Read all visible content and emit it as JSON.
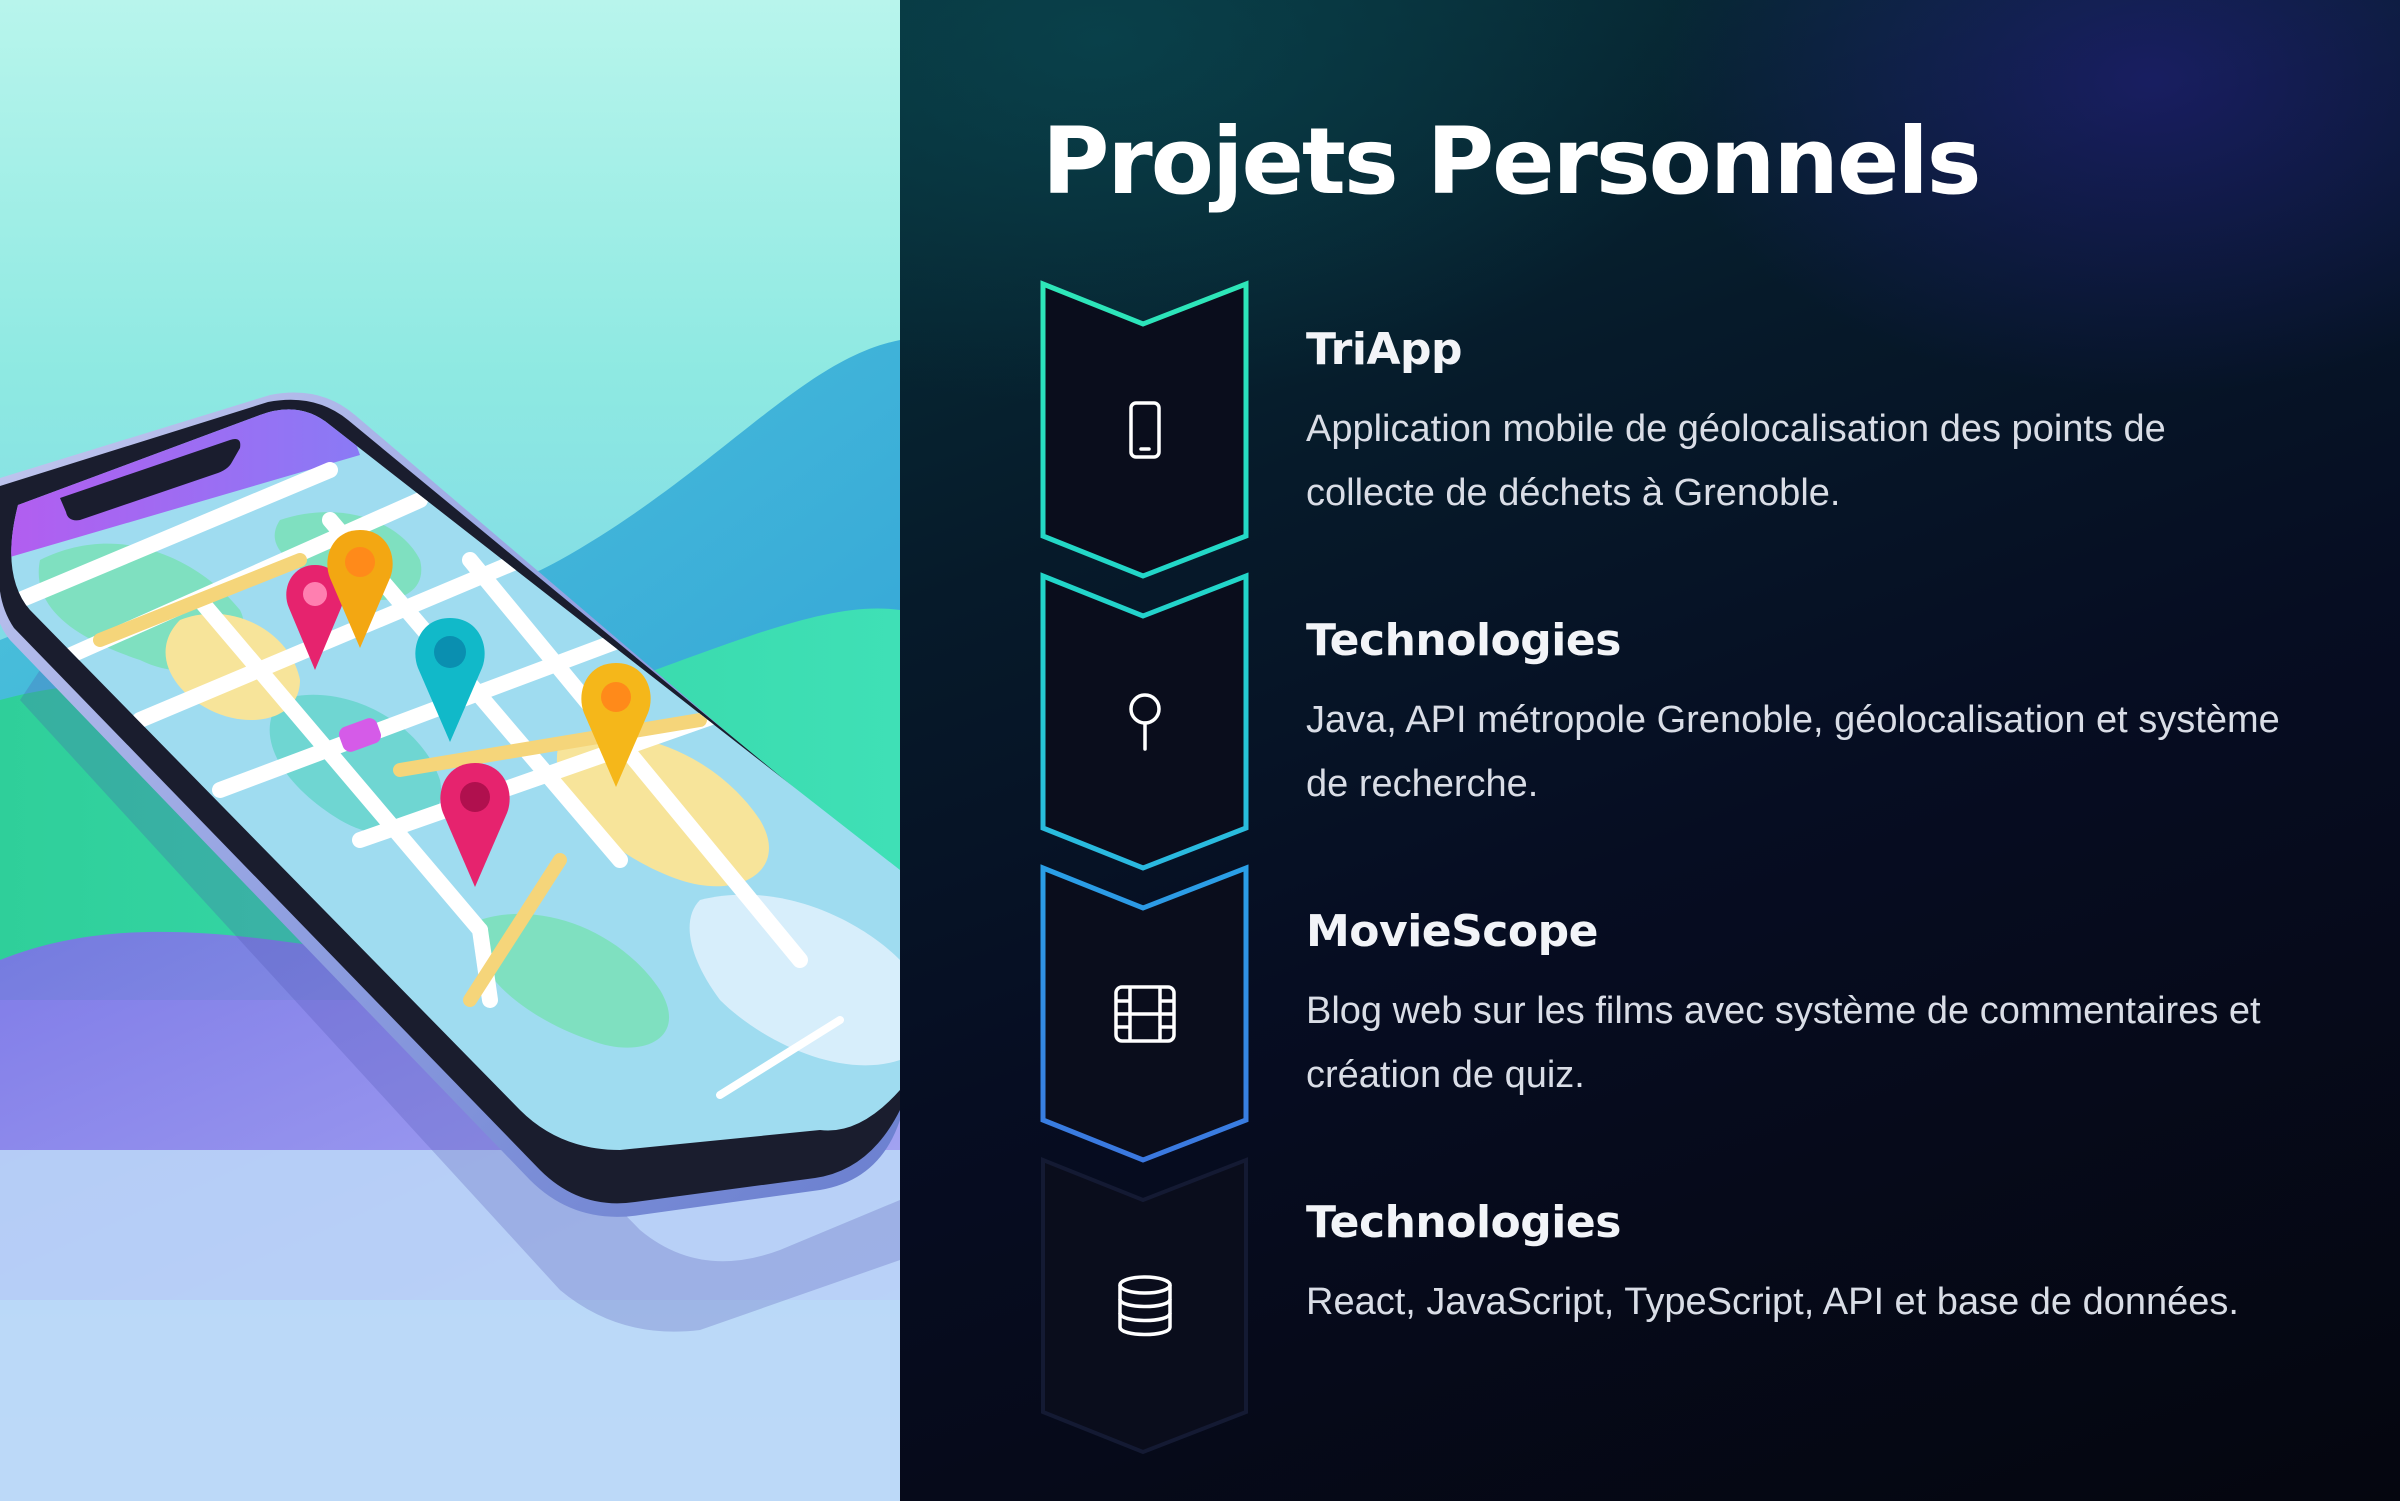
{
  "header": {
    "title": "Projets Personnels"
  },
  "items": [
    {
      "icon": "smartphone-icon",
      "title": "TriApp",
      "description": "Application mobile de géolocalisation des points de collecte de déchets à Grenoble."
    },
    {
      "icon": "map-pin-icon",
      "title": "Technologies",
      "description": "Java, API métropole Grenoble, géolocalisation et système de recherche."
    },
    {
      "icon": "film-icon",
      "title": "MovieScope",
      "description": "Blog web sur les films avec système de commentaires et création de quiz."
    },
    {
      "icon": "database-icon",
      "title": "Technologies",
      "description": "React, JavaScript, TypeScript, API et base de données."
    }
  ],
  "colors": {
    "accent_teal": "#2ee6b8",
    "accent_cyan": "#22c9dd",
    "accent_blue": "#3b8ee6",
    "background_dark": "#05070f"
  }
}
